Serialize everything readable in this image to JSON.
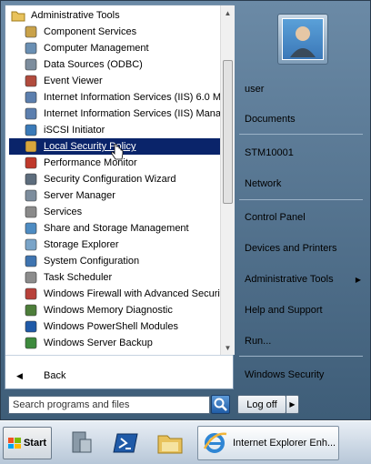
{
  "programs": {
    "folder_label": "Administrative Tools",
    "items": [
      {
        "label": "Component Services",
        "icon": "component-services-icon"
      },
      {
        "label": "Computer Management",
        "icon": "computer-management-icon"
      },
      {
        "label": "Data Sources (ODBC)",
        "icon": "data-sources-icon"
      },
      {
        "label": "Event Viewer",
        "icon": "event-viewer-icon"
      },
      {
        "label": "Internet Information Services (IIS) 6.0 M",
        "icon": "iis6-icon"
      },
      {
        "label": "Internet Information Services (IIS) Mana",
        "icon": "iis-manager-icon"
      },
      {
        "label": "iSCSI Initiator",
        "icon": "iscsi-icon"
      },
      {
        "label": "Local Security Policy",
        "icon": "security-policy-icon"
      },
      {
        "label": "Performance Monitor",
        "icon": "performance-monitor-icon"
      },
      {
        "label": "Security Configuration Wizard",
        "icon": "security-wizard-icon"
      },
      {
        "label": "Server Manager",
        "icon": "server-manager-icon"
      },
      {
        "label": "Services",
        "icon": "services-gear-icon"
      },
      {
        "label": "Share and Storage Management",
        "icon": "share-storage-icon"
      },
      {
        "label": "Storage Explorer",
        "icon": "storage-explorer-icon"
      },
      {
        "label": "System Configuration",
        "icon": "system-config-icon"
      },
      {
        "label": "Task Scheduler",
        "icon": "clock-icon"
      },
      {
        "label": "Windows Firewall with Advanced Securit",
        "icon": "firewall-icon"
      },
      {
        "label": "Windows Memory Diagnostic",
        "icon": "memory-icon"
      },
      {
        "label": "Windows PowerShell Modules",
        "icon": "powershell-icon"
      },
      {
        "label": "Windows Server Backup",
        "icon": "backup-icon"
      }
    ],
    "selected_index": 7
  },
  "back_label": "Back",
  "search": {
    "placeholder": "Search programs and files"
  },
  "right_pane": {
    "items": [
      {
        "label": "user"
      },
      {
        "label": "Documents"
      },
      {
        "label": "STM10001"
      },
      {
        "label": "Network"
      },
      {
        "label": "Control Panel"
      },
      {
        "label": "Devices and Printers"
      },
      {
        "label": "Administrative Tools",
        "submenu": true
      },
      {
        "label": "Help and Support"
      },
      {
        "label": "Run..."
      },
      {
        "label": "Windows Security"
      }
    ]
  },
  "logoff_label": "Log off",
  "taskbar": {
    "start_label": "Start",
    "task_label": "Internet Explorer Enh..."
  },
  "colors": {
    "selection": "#0a246a",
    "menu_frame": "#4e6f8e"
  }
}
